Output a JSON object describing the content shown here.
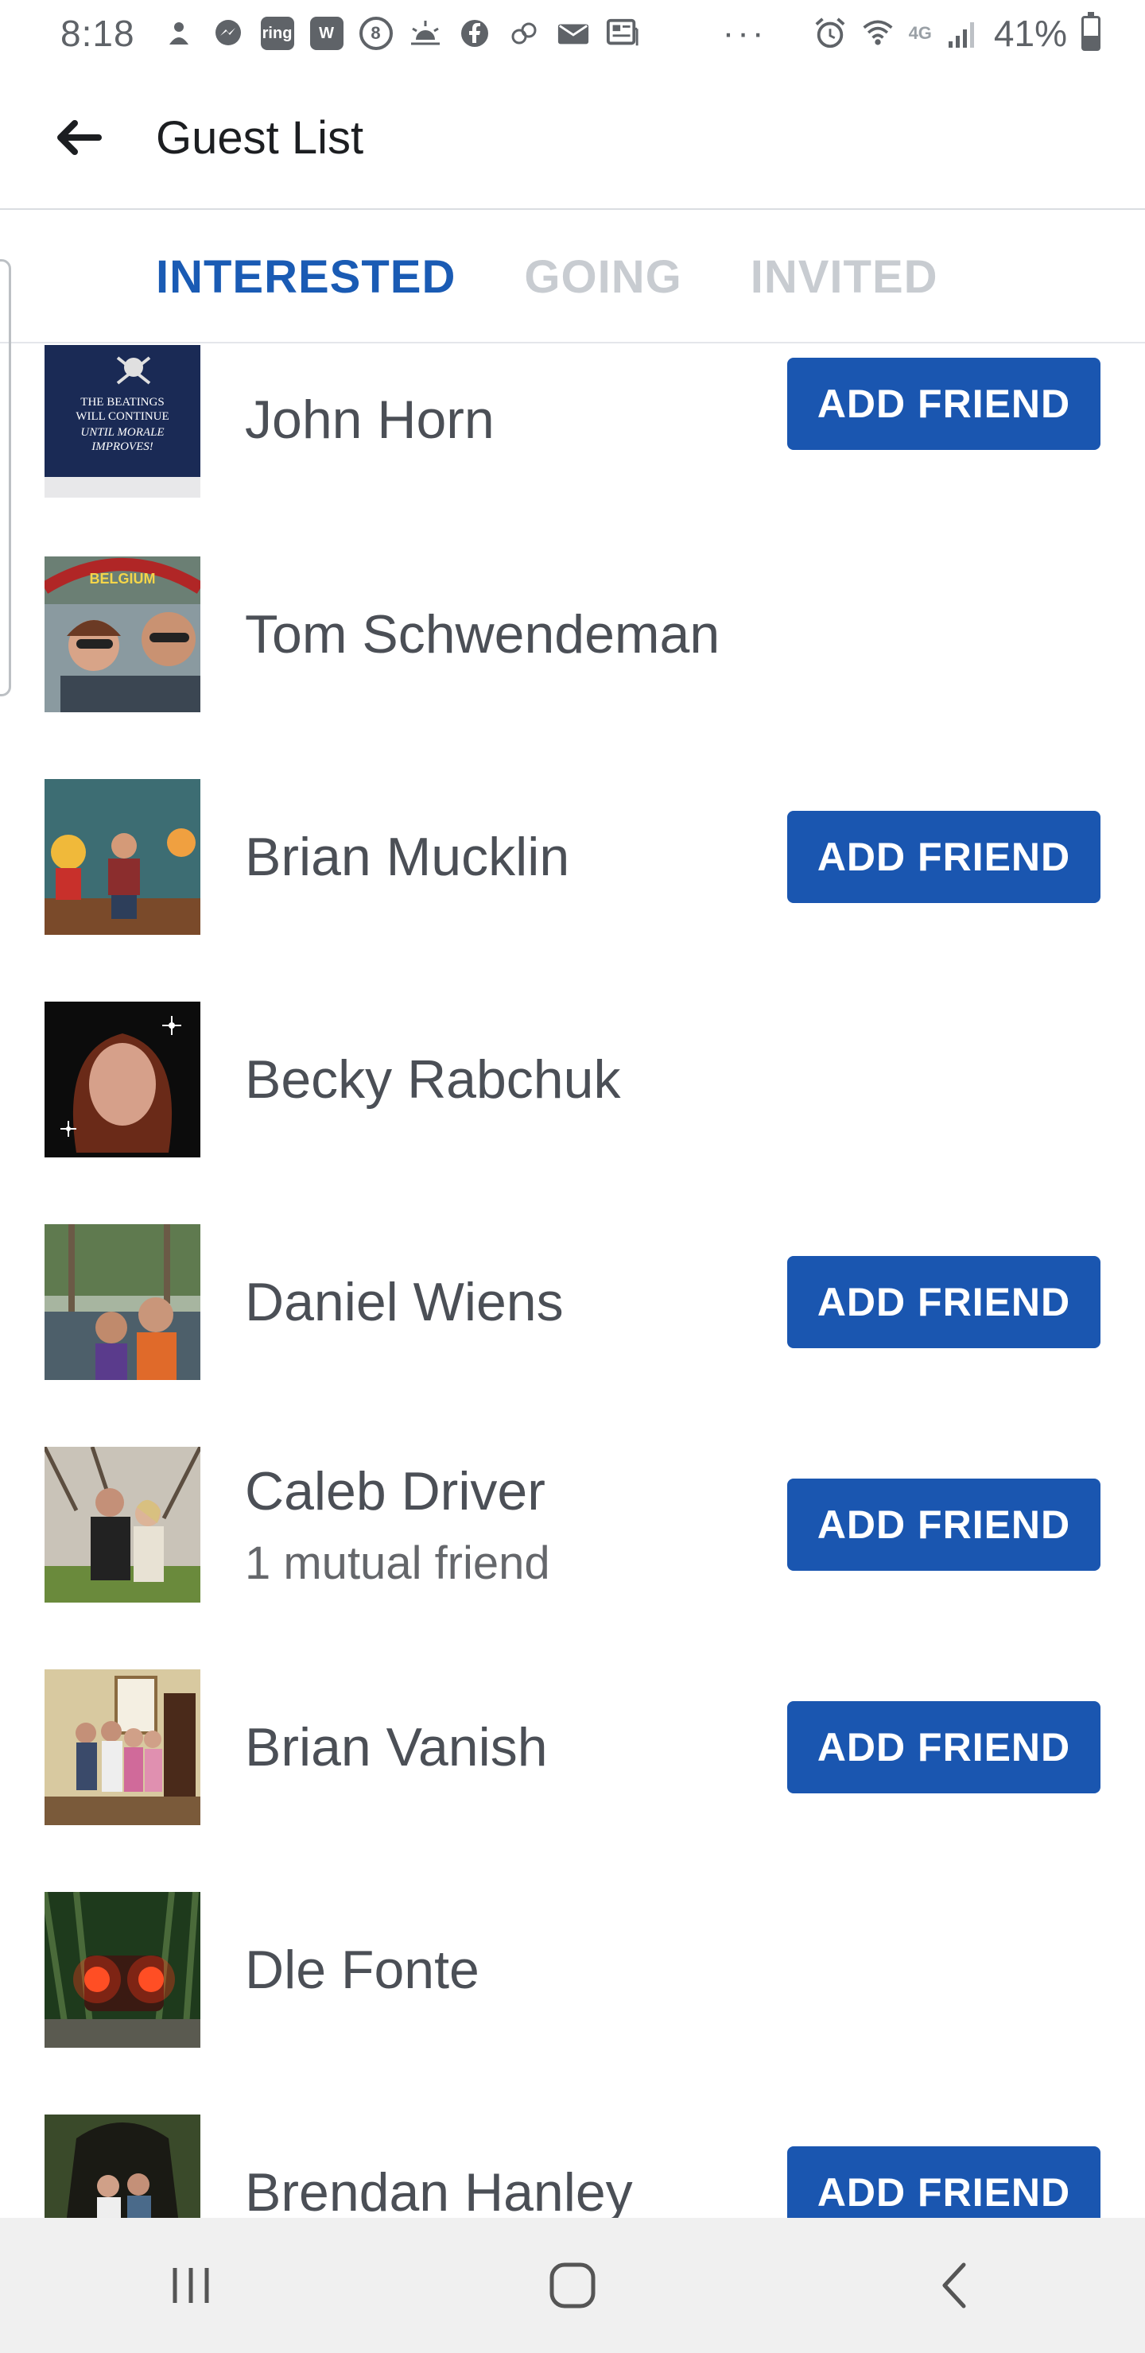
{
  "status_bar": {
    "time": "8:18",
    "ring_label": "ring",
    "w_label": "W",
    "eight_label": "8",
    "network": "4G",
    "battery_percent": "41%",
    "battery_level": 0.41,
    "overflow": "···"
  },
  "header": {
    "title": "Guest List"
  },
  "tabs": [
    {
      "label": "INTERESTED",
      "active": true
    },
    {
      "label": "GOING",
      "active": false
    },
    {
      "label": "INVITED",
      "active": false
    }
  ],
  "add_friend_label": "ADD FRIEND",
  "guests": [
    {
      "name": "John Horn",
      "sub": "",
      "add_friend": true,
      "avatar_text": [
        "THE BEATINGS",
        "WILL CONTINUE",
        "UNTIL MORALE",
        "IMPROVES!"
      ]
    },
    {
      "name": "Tom Schwendeman",
      "sub": "",
      "add_friend": false,
      "avatar_text": [
        "BELGIUM"
      ]
    },
    {
      "name": "Brian Mucklin",
      "sub": "",
      "add_friend": true
    },
    {
      "name": "Becky Rabchuk",
      "sub": "",
      "add_friend": false
    },
    {
      "name": "Daniel Wiens",
      "sub": "",
      "add_friend": true
    },
    {
      "name": "Caleb Driver",
      "sub": "1 mutual friend",
      "add_friend": true
    },
    {
      "name": "Brian Vanish",
      "sub": "",
      "add_friend": true
    },
    {
      "name": "Dle Fonte",
      "sub": "",
      "add_friend": false
    },
    {
      "name": "Brendan Hanley",
      "sub": "",
      "add_friend": true
    }
  ],
  "colors": {
    "accent": "#1a56b0",
    "tab_active": "#1a5bb4",
    "tab_inactive": "#c8ccd1"
  }
}
